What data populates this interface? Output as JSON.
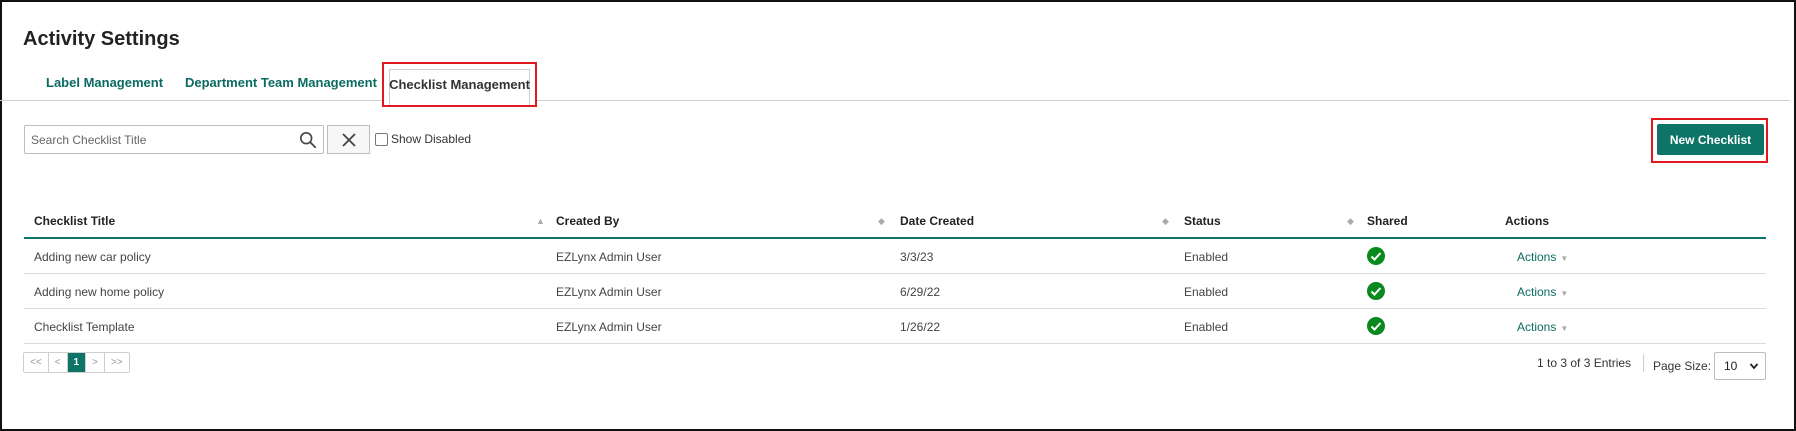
{
  "page": {
    "title": "Activity Settings"
  },
  "tabs": [
    {
      "label": "Label Management"
    },
    {
      "label": "Department Team Management"
    },
    {
      "label": "Checklist Management",
      "active": true
    }
  ],
  "toolbar": {
    "search_placeholder": "Search Checklist Title",
    "search_value": "",
    "show_disabled_label": "Show Disabled",
    "show_disabled_checked": false,
    "new_checklist_label": "New Checklist"
  },
  "table": {
    "columns": [
      "Checklist Title",
      "Created By",
      "Date Created",
      "Status",
      "Shared",
      "Actions"
    ],
    "rows": [
      {
        "title": "Adding new car policy",
        "created_by": "EZLynx Admin User",
        "date": "3/3/23",
        "status": "Enabled",
        "shared": true,
        "actions": "Actions"
      },
      {
        "title": "Adding new home policy",
        "created_by": "EZLynx Admin User",
        "date": "6/29/22",
        "status": "Enabled",
        "shared": true,
        "actions": "Actions"
      },
      {
        "title": "Checklist Template",
        "created_by": "EZLynx Admin User",
        "date": "1/26/22",
        "status": "Enabled",
        "shared": true,
        "actions": "Actions"
      }
    ]
  },
  "pagination": {
    "first": "<<",
    "prev": "<",
    "current": "1",
    "next": ">",
    "last": ">>",
    "entries_text": "1 to 3 of 3 Entries",
    "page_size_label": "Page Size:",
    "page_size_value": "10"
  },
  "colors": {
    "accent": "#0e7468",
    "highlight": "#e0191f",
    "shared_check": "#0a8a1e"
  }
}
